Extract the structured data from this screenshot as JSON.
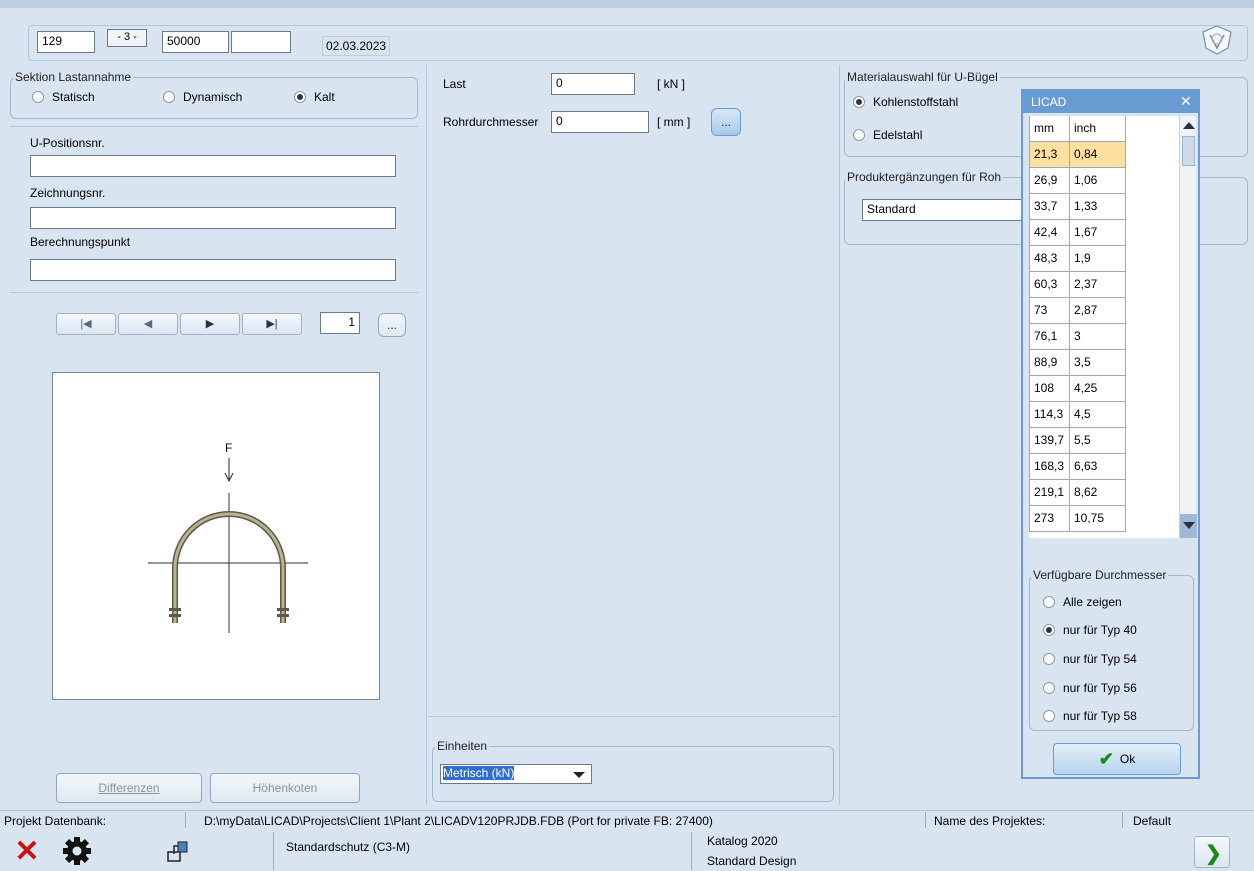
{
  "header": {
    "field1": "129",
    "field2": "- 3 -",
    "field3": "50000",
    "field4": "",
    "date": "02.03.2023"
  },
  "sektion": {
    "title": "Sektion Lastannahme",
    "options": [
      "Statisch",
      "Dynamisch",
      "Kalt"
    ],
    "selected": "Kalt"
  },
  "fields": {
    "upos_label": "U-Positionsnr.",
    "upos_value": "",
    "zeich_label": "Zeichnungsnr.",
    "zeich_value": "",
    "berech_label": "Berechnungspunkt",
    "berech_value": ""
  },
  "nav": {
    "first": "|◀",
    "prev": "◀",
    "next": "▶",
    "last": "▶|",
    "page": "1",
    "more": "..."
  },
  "drawing": {
    "force_label": "F"
  },
  "buttons": {
    "differenzen": "Differenzen",
    "hoehenkoten": "Höhenkoten"
  },
  "last": {
    "label": "Last",
    "value": "0",
    "unit": "[ kN ]",
    "rohr_label": "Rohrdurchmesser",
    "rohr_value": "0",
    "rohr_unit": "[ mm ]",
    "browse": "..."
  },
  "einheiten": {
    "title": "Einheiten",
    "value": "Metrisch (kN)"
  },
  "material": {
    "title": "Materialauswahl für U-Bügel",
    "options": [
      "Kohlenstoffstahl",
      "Edelstahl"
    ],
    "selected": "Kohlenstoffstahl"
  },
  "produkt": {
    "title": "Produktergänzungen für Roh",
    "value": "Standard"
  },
  "licad": {
    "title": "LICAD",
    "close": "✕",
    "columns": [
      "mm",
      "inch"
    ],
    "rows": [
      [
        "21,3",
        "0,84"
      ],
      [
        "26,9",
        "1,06"
      ],
      [
        "33,7",
        "1,33"
      ],
      [
        "42,4",
        "1,67"
      ],
      [
        "48,3",
        "1,9"
      ],
      [
        "60,3",
        "2,37"
      ],
      [
        "73",
        "2,87"
      ],
      [
        "76,1",
        "3"
      ],
      [
        "88,9",
        "3,5"
      ],
      [
        "108",
        "4,25"
      ],
      [
        "114,3",
        "4,5"
      ],
      [
        "139,7",
        "5,5"
      ],
      [
        "168,3",
        "6,63"
      ],
      [
        "219,1",
        "8,62"
      ],
      [
        "273",
        "10,75"
      ]
    ],
    "selected_row": 0,
    "durchmesser_title": "Verfügbare Durchmesser",
    "options": [
      "Alle zeigen",
      "nur für Typ 40",
      "nur für Typ 54",
      "nur für Typ 56",
      "nur für Typ 58"
    ],
    "selected_option": "nur für Typ 40",
    "ok": "Ok"
  },
  "statusbar": {
    "projekt_label": "Projekt Datenbank:",
    "path": "D:\\myData\\LICAD\\Projects\\Client 1\\Plant 2\\LICADV120PRJDB.FDB (Port for private FB: 27400)",
    "name_label": "Name des Projektes:",
    "name_value": "Default",
    "schutz": "Standardschutz (C3-M)",
    "katalog": "Katalog 2020",
    "design": "Standard Design"
  },
  "colors": {
    "background": "#d8e4ef",
    "accent": "#6a9cd4",
    "selected_row": "#fbe0a0",
    "close_red": "#cc1111",
    "next_green": "#1a8a1a"
  }
}
